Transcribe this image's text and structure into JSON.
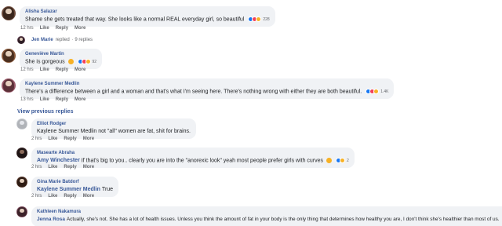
{
  "comments": [
    {
      "author": "Alisha Salazar",
      "text": "Shame she gets treated that way. She looks like a normal REAL everyday girl, so beautiful",
      "reaction_count": "228",
      "time": "12 hrs",
      "like": "Like",
      "reply": "Reply",
      "more": "More",
      "avatar_color": "#6b4a3a"
    },
    {
      "author": "Geneviève Martin",
      "text": "She is gorgeous",
      "reaction_count": "92",
      "time": "12 hrs",
      "like": "Like",
      "reply": "Reply",
      "more": "More",
      "avatar_color": "#8a5a3c"
    },
    {
      "author": "Kaylene Summer Medlin",
      "text": "There's a difference between a girl and a woman and that's what I'm seeing here. There's nothing wrong with either they are both beautiful.",
      "reaction_count": "1.4K",
      "time": "13 hrs",
      "like": "Like",
      "reply": "Reply",
      "more": "More",
      "avatar_color": "#9b5b6b"
    }
  ],
  "replies_summary": {
    "name": "Jen Marie",
    "action": "replied",
    "count": "· 9 replies"
  },
  "view_previous": "View previous replies",
  "replies": [
    {
      "author": "Elliot Rodger",
      "mention": "",
      "text": "Kaylene Summer Medlin not \"all\" women are fat, shit for brains.",
      "time": "2 hrs",
      "like": "Like",
      "reply": "Reply",
      "more": "More",
      "avatar_color": "#c9ccd1"
    },
    {
      "author": "Masearte Abraha",
      "mention": "Amy Winchester",
      "text": "If that's big to you.. clearly you are into the \"anorexic look\" yeah most people prefer girls with curves",
      "reaction_count": "2",
      "time": "2 hrs",
      "like": "Like",
      "reply": "Reply",
      "more": "More",
      "avatar_color": "#3b2a2a"
    },
    {
      "author": "Gina Marie Batdorf",
      "mention": "Kaylene Summer Medlin",
      "text": "True",
      "time": "2 hrs",
      "like": "Like",
      "reply": "Reply",
      "more": "More",
      "avatar_color": "#5a3b2e"
    },
    {
      "author": "Kathleen Nakamura",
      "mention": "Jenna Rosa",
      "text": "Actually, she's not. She has a lot of health issues. Unless you think the amount of fat in your body is the only thing that determines how healthy you are, I don't think she's healthier than most of us.",
      "time": "",
      "avatar_color": "#7a4a5a"
    }
  ],
  "colors": {
    "link_blue": "#385898",
    "bubble_bg": "#f0f2f5",
    "meta_gray": "#65676b",
    "like_blue": "#1877f2",
    "love_red": "#f33e58",
    "haha_yellow": "#f7b125"
  }
}
